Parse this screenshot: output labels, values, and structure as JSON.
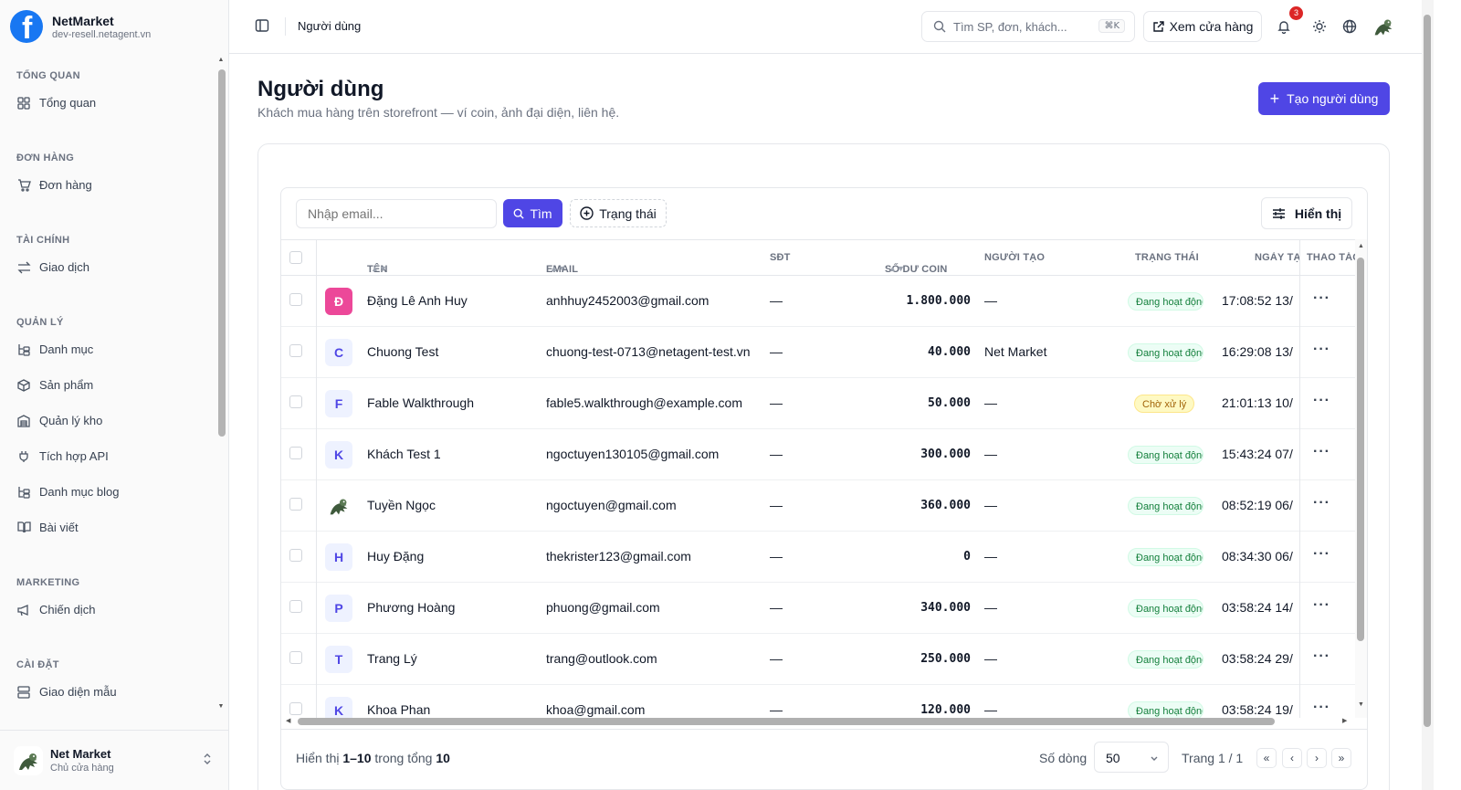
{
  "brand": {
    "name": "NetMarket",
    "domain": "dev-resell.netagent.vn",
    "logo_letter": "f",
    "logo_color": "#1877f2"
  },
  "sidebar": {
    "sections": [
      {
        "title": "TỔNG QUAN",
        "items": [
          {
            "label": "Tổng quan",
            "icon": "dashboard-icon"
          }
        ]
      },
      {
        "title": "ĐƠN HÀNG",
        "items": [
          {
            "label": "Đơn hàng",
            "icon": "cart-icon"
          }
        ]
      },
      {
        "title": "TÀI CHÍNH",
        "items": [
          {
            "label": "Giao dịch",
            "icon": "transfer-icon"
          }
        ]
      },
      {
        "title": "QUẢN LÝ",
        "items": [
          {
            "label": "Danh mục",
            "icon": "category-icon"
          },
          {
            "label": "Sản phẩm",
            "icon": "box-icon"
          },
          {
            "label": "Quản lý kho",
            "icon": "warehouse-icon"
          },
          {
            "label": "Tích hợp API",
            "icon": "plug-icon"
          },
          {
            "label": "Danh mục blog",
            "icon": "category-icon"
          },
          {
            "label": "Bài viết",
            "icon": "book-icon"
          }
        ]
      },
      {
        "title": "MARKETING",
        "items": [
          {
            "label": "Chiến dịch",
            "icon": "megaphone-icon"
          }
        ]
      },
      {
        "title": "CÀI ĐẶT",
        "items": [
          {
            "label": "Giao diện mẫu",
            "icon": "template-icon"
          }
        ]
      }
    ],
    "footer": {
      "name": "Net Market",
      "role": "Chủ cửa hàng"
    }
  },
  "topbar": {
    "breadcrumb": "Người dùng",
    "search_placeholder": "Tìm SP, đơn, khách...",
    "search_shortcut": "⌘K",
    "store_button": "Xem cửa hàng",
    "notification_count": "3"
  },
  "page": {
    "title": "Người dùng",
    "subtitle": "Khách mua hàng trên storefront — ví coin, ảnh đại diện, liên hệ.",
    "create_button": "Tạo người dùng"
  },
  "toolbar": {
    "email_placeholder": "Nhập email...",
    "search_button": "Tìm",
    "status_filter": "Trạng thái",
    "display_button": "Hiển thị"
  },
  "table": {
    "columns": {
      "name": "TÊN",
      "email": "EMAIL",
      "phone": "SĐT",
      "coin": "SỐ DƯ COIN",
      "creator": "NGƯỜI TẠO",
      "status": "TRẠNG THÁI",
      "created": "NGÀY TẠO",
      "actions": "THAO TÁC"
    },
    "rows": [
      {
        "initial": "Đ",
        "avatar_style": "pink",
        "name": "Đặng Lê Anh Huy",
        "email": "anhhuy2452003@gmail.com",
        "phone": "—",
        "coin": "1.800.000",
        "creator": "—",
        "status": "Đang hoạt động",
        "status_type": "active",
        "created": "17:08:52 13/"
      },
      {
        "initial": "C",
        "avatar_style": "light",
        "name": "Chuong Test",
        "email": "chuong-test-0713@netagent-test.vn",
        "phone": "—",
        "coin": "40.000",
        "creator": "Net Market",
        "status": "Đang hoạt động",
        "status_type": "active",
        "created": "16:29:08 13/"
      },
      {
        "initial": "F",
        "avatar_style": "light",
        "name": "Fable Walkthrough",
        "email": "fable5.walkthrough@example.com",
        "phone": "—",
        "coin": "50.000",
        "creator": "—",
        "status": "Chờ xử lý",
        "status_type": "pending",
        "created": "21:01:13 10/"
      },
      {
        "initial": "K",
        "avatar_style": "light",
        "name": "Khách Test 1",
        "email": "ngoctuyen130105@gmail.com",
        "phone": "—",
        "coin": "300.000",
        "creator": "—",
        "status": "Đang hoạt động",
        "status_type": "active",
        "created": "15:43:24 07/"
      },
      {
        "initial": "",
        "avatar_style": "image",
        "name": "Tuyền Ngọc",
        "email": "ngoctuyen@gmail.com",
        "phone": "—",
        "coin": "360.000",
        "creator": "—",
        "status": "Đang hoạt động",
        "status_type": "active",
        "created": "08:52:19 06/"
      },
      {
        "initial": "H",
        "avatar_style": "light",
        "name": "Huy Đặng",
        "email": "thekrister123@gmail.com",
        "phone": "—",
        "coin": "0",
        "creator": "—",
        "status": "Đang hoạt động",
        "status_type": "active",
        "created": "08:34:30 06/"
      },
      {
        "initial": "P",
        "avatar_style": "light",
        "name": "Phương Hoàng",
        "email": "phuong@gmail.com",
        "phone": "—",
        "coin": "340.000",
        "creator": "—",
        "status": "Đang hoạt động",
        "status_type": "active",
        "created": "03:58:24 14/"
      },
      {
        "initial": "T",
        "avatar_style": "light",
        "name": "Trang Lý",
        "email": "trang@outlook.com",
        "phone": "—",
        "coin": "250.000",
        "creator": "—",
        "status": "Đang hoạt động",
        "status_type": "active",
        "created": "03:58:24 29/"
      },
      {
        "initial": "K",
        "avatar_style": "light",
        "name": "Khoa Phan",
        "email": "khoa@gmail.com",
        "phone": "—",
        "coin": "120.000",
        "creator": "—",
        "status": "Đang hoạt động",
        "status_type": "active",
        "created": "03:58:24 19/"
      }
    ]
  },
  "pagination": {
    "info_prefix": "Hiển thị",
    "range": "1–10",
    "info_middle": "trong tổng",
    "total": "10",
    "rows_label": "Số dòng",
    "rows_value": "50",
    "page_label": "Trang 1 / 1"
  },
  "colors": {
    "accent": "#4f46e5",
    "active_badge": "#15803d",
    "pending_badge": "#a16207"
  }
}
